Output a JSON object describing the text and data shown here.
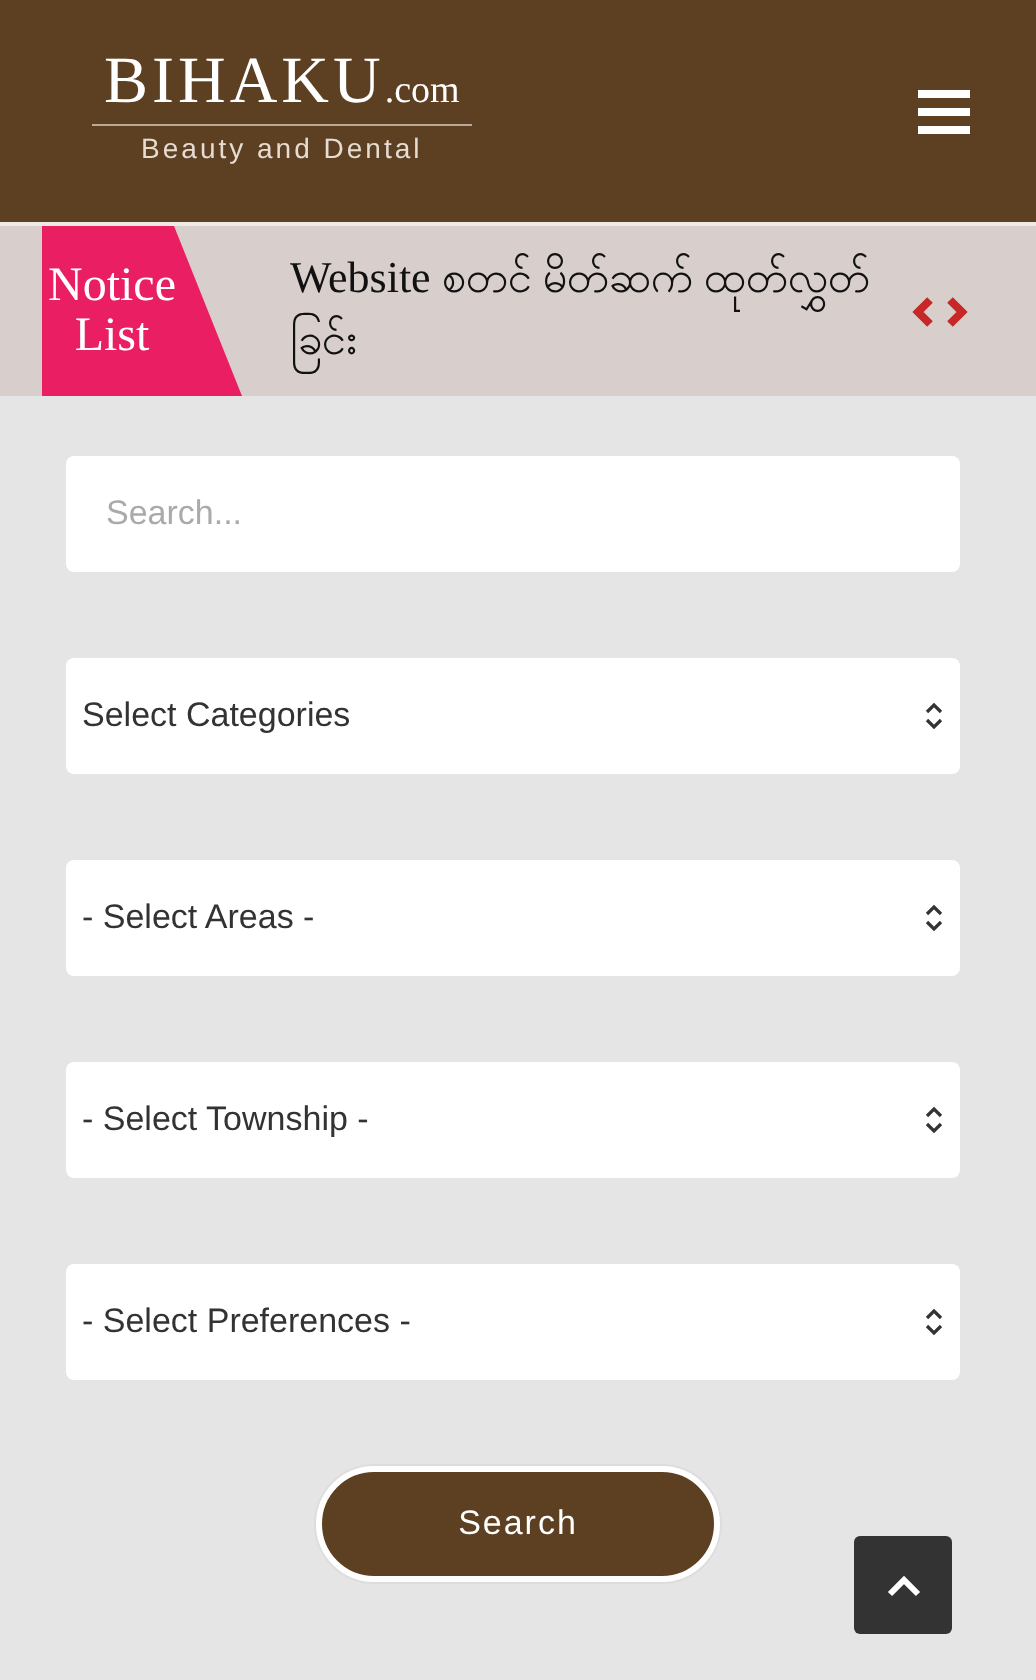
{
  "header": {
    "logo": {
      "name": "BIHAKU",
      "suffix": ".com",
      "tagline": "Beauty and Dental"
    }
  },
  "notice": {
    "label": [
      "Notice",
      "List"
    ],
    "text": "Website စတင် မိတ်ဆက် ထုတ်လွှတ်ခြင်း"
  },
  "search": {
    "placeholder": "Search..."
  },
  "selects": [
    {
      "value": "Select Categories"
    },
    {
      "value": "- Select Areas -"
    },
    {
      "value": "- Select Township -"
    },
    {
      "value": "- Select Preferences -"
    }
  ],
  "submit": "Search"
}
